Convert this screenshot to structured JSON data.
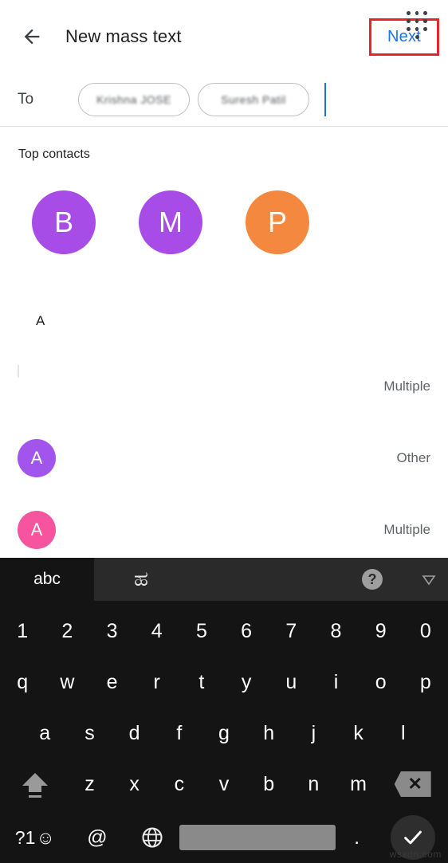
{
  "header": {
    "back_icon": "arrow-back-icon",
    "title": "New mass text",
    "next_label": "Next",
    "next_color": "#1a73e8",
    "highlight_color": "#e8232a"
  },
  "recipients": {
    "to_label": "To",
    "chips": [
      {
        "name": "Krishna JOSE",
        "redacted": true
      },
      {
        "name": "Suresh Patil",
        "redacted": true
      }
    ],
    "dialpad_icon": "dialpad-icon"
  },
  "top_contacts": {
    "title": "Top contacts",
    "avatars": [
      {
        "initial": "B",
        "color": "#a84ce8"
      },
      {
        "initial": "M",
        "color": "#a84ce8"
      },
      {
        "initial": "P",
        "color": "#f3883e"
      }
    ]
  },
  "contact_list": {
    "section_letter": "A",
    "rows": [
      {
        "initial": "",
        "color": "#ffffff",
        "name": "",
        "type": "Multiple",
        "redacted": true
      },
      {
        "initial": "A",
        "color": "#a255ec",
        "name": "",
        "type": "Other",
        "redacted": false
      },
      {
        "initial": "A",
        "color": "#f6549f",
        "name": "",
        "type": "Multiple",
        "redacted": false
      }
    ]
  },
  "keyboard": {
    "toolbar": {
      "abc_tab": "abc",
      "language_tab": "ಹ",
      "help_icon": "help-icon",
      "help_label": "?",
      "collapse_icon": "chevron-down-icon"
    },
    "rows": {
      "numbers": [
        "1",
        "2",
        "3",
        "4",
        "5",
        "6",
        "7",
        "8",
        "9",
        "0"
      ],
      "top": [
        "q",
        "w",
        "e",
        "r",
        "t",
        "y",
        "u",
        "i",
        "o",
        "p"
      ],
      "home": [
        "a",
        "s",
        "d",
        "f",
        "g",
        "h",
        "j",
        "k",
        "l"
      ],
      "bottom": [
        "z",
        "x",
        "c",
        "v",
        "b",
        "n",
        "m"
      ]
    },
    "shift_icon": "shift-icon",
    "backspace_icon": "backspace-icon",
    "symbols_label": "?1",
    "emoji_label": "☺",
    "at_label": "@",
    "globe_icon": "globe-icon",
    "space_label": "",
    "period_label": ".",
    "enter_icon": "check-icon"
  },
  "watermark": "wsxdn.com"
}
